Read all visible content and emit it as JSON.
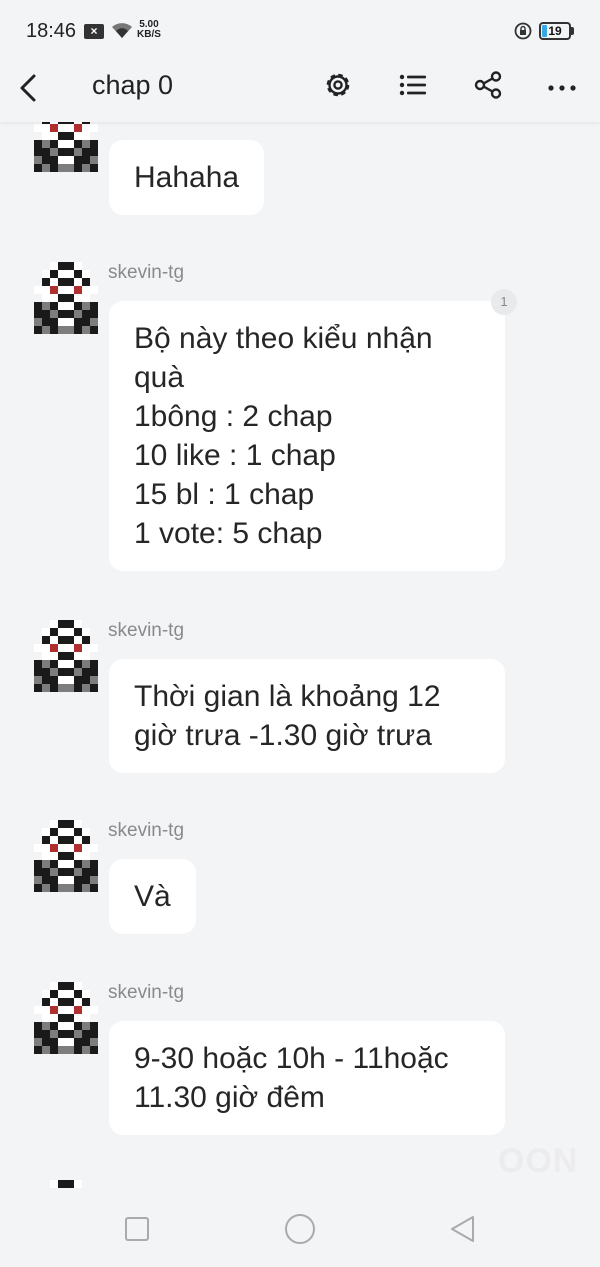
{
  "status": {
    "time": "18:46",
    "speed_value": "5.00",
    "speed_unit": "KB/S",
    "battery": "19",
    "battery_level": 0.19
  },
  "header": {
    "title": "chap 0",
    "icons": [
      "back-icon",
      "gear-icon",
      "list-icon",
      "share-icon",
      "more-icon"
    ]
  },
  "messages": [
    {
      "username": "",
      "text": "Hahaha"
    },
    {
      "username": "skevin-tg",
      "text": "Bộ này theo kiểu nhận\nquà\n1bông : 2 chap\n10 like : 1 chap\n15 bl : 1 chap\n1 vote: 5 chap",
      "likes": "1"
    },
    {
      "username": "skevin-tg",
      "text": "Thời gian là khoảng 12\ngiờ trưa -1.30 giờ trưa"
    },
    {
      "username": "skevin-tg",
      "text": "Và"
    },
    {
      "username": "skevin-tg",
      "text": "9-30 hoặc 10h - 11hoặc\n11.30 giờ đêm"
    }
  ],
  "watermark": "OON",
  "colors": {
    "background": "#f3f4f6",
    "bubble": "#ffffff",
    "username": "#8a8a8a"
  }
}
